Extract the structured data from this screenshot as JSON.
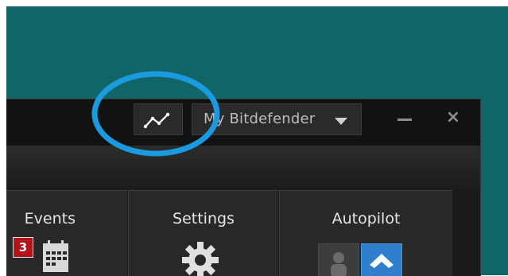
{
  "window": {
    "account_label": "My Bitdefender",
    "icons": {
      "graph": "activity-graph-icon",
      "dropdown": "triangle-down-icon",
      "minimize": "minimize-icon",
      "close": "close-icon"
    },
    "close_glyph": "×"
  },
  "panels": [
    {
      "title": "Events",
      "icon": "calendar-icon",
      "badge": "3"
    },
    {
      "title": "Settings",
      "icon": "gear-icon"
    },
    {
      "title": "Autopilot",
      "icon": "autopilot-toggle"
    }
  ],
  "colors": {
    "desktop": "#116566",
    "annotation": "#1a9be0",
    "badge": "#b31419",
    "toggle_active": "#2f7fce"
  }
}
